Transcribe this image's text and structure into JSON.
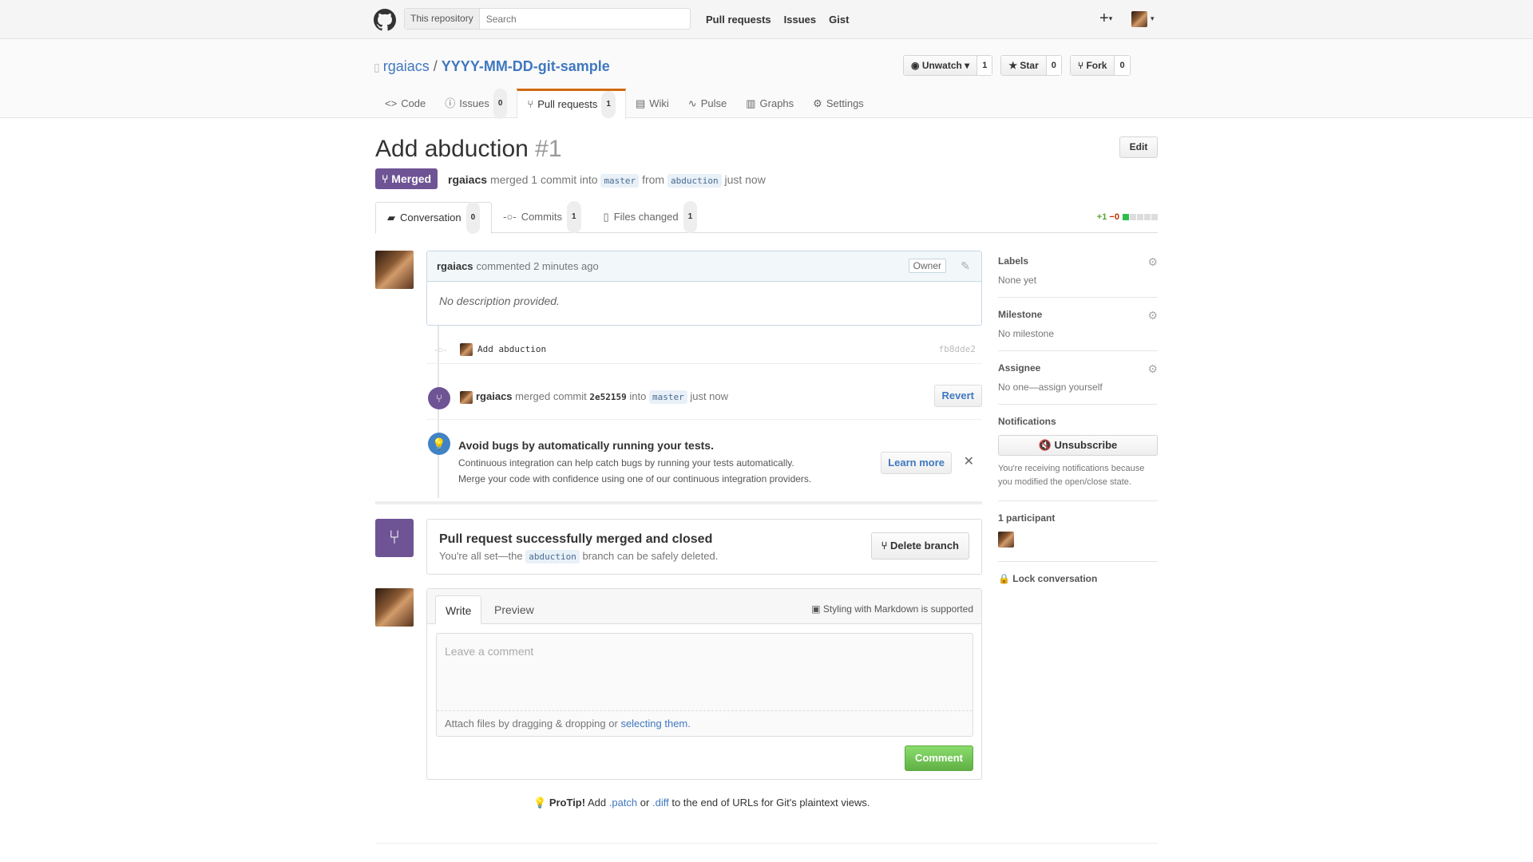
{
  "header": {
    "scope_label": "This repository",
    "search_placeholder": "Search",
    "nav": [
      "Pull requests",
      "Issues",
      "Gist"
    ],
    "plus_label": "+"
  },
  "repo": {
    "owner": "rgaiacs",
    "separator": "/",
    "name": "YYYY-MM-DD-git-sample",
    "unwatch_label": "Unwatch",
    "unwatch_count": "1",
    "star_label": "Star",
    "star_count": "0",
    "fork_label": "Fork",
    "fork_count": "0",
    "tabs": {
      "code": "Code",
      "issues": "Issues",
      "issues_count": "0",
      "pulls": "Pull requests",
      "pulls_count": "1",
      "wiki": "Wiki",
      "pulse": "Pulse",
      "graphs": "Graphs",
      "settings": "Settings"
    }
  },
  "pr": {
    "title": "Add abduction",
    "number": "#1",
    "edit_label": "Edit",
    "state": "Merged",
    "author": "rgaiacs",
    "merged_text": "merged 1 commit into",
    "base_branch": "master",
    "from_text": "from",
    "head_branch": "abduction",
    "when": "just now",
    "tabs": {
      "conversation": "Conversation",
      "conversation_count": "0",
      "commits": "Commits",
      "commits_count": "1",
      "files": "Files changed",
      "files_count": "1"
    },
    "diff_add": "+1",
    "diff_del": "−0"
  },
  "comment": {
    "author": "rgaiacs",
    "meta": "commented 2 minutes ago",
    "owner_badge": "Owner",
    "body": "No description provided."
  },
  "commit": {
    "message": "Add abduction",
    "sha": "fb8dde2"
  },
  "merge_event": {
    "author": "rgaiacs",
    "text1": "merged commit",
    "sha": "2e52159",
    "text2": "into",
    "branch": "master",
    "when": "just now",
    "revert_label": "Revert"
  },
  "ci": {
    "title": "Avoid bugs by automatically running your tests.",
    "line1": "Continuous integration can help catch bugs by running your tests automatically.",
    "line2": "Merge your code with confidence using one of our continuous integration providers.",
    "learn_label": "Learn more",
    "close": "✕"
  },
  "merge_box": {
    "title": "Pull request successfully merged and closed",
    "text_before": "You're all set—the",
    "branch": "abduction",
    "text_after": "branch can be safely deleted.",
    "delete_label": "Delete branch"
  },
  "form": {
    "write_tab": "Write",
    "preview_tab": "Preview",
    "markdown_note": "Styling with Markdown is supported",
    "placeholder": "Leave a comment",
    "attach_text": "Attach files by dragging & dropping or",
    "attach_link": "selecting them.",
    "submit_label": "Comment"
  },
  "protip": {
    "label": "ProTip!",
    "t1": "Add",
    "patch": ".patch",
    "t2": "or",
    "diff": ".diff",
    "t3": "to the end of URLs for Git's plaintext views."
  },
  "sidebar": {
    "labels_title": "Labels",
    "labels_value": "None yet",
    "milestone_title": "Milestone",
    "milestone_value": "No milestone",
    "assignee_title": "Assignee",
    "assignee_value": "No one—assign yourself",
    "notifications_title": "Notifications",
    "unsubscribe_label": "Unsubscribe",
    "notifications_reason": "You're receiving notifications because you modified the open/close state.",
    "participants_title": "1 participant",
    "lock_label": "Lock conversation"
  },
  "colors": {
    "merged": "#6e5494",
    "link": "#4078c0",
    "green": "#60b044",
    "tab_accent": "#d26911"
  }
}
